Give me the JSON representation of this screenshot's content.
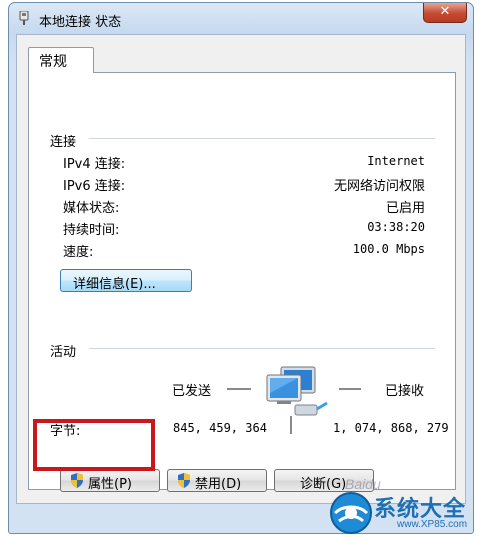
{
  "window": {
    "title": "本地连接 状态",
    "close_label": "✕"
  },
  "tabs": [
    {
      "label": "常规"
    }
  ],
  "connection": {
    "section_title": "连接",
    "rows": [
      {
        "label": "IPv4 连接:",
        "value": "Internet"
      },
      {
        "label": "IPv6 连接:",
        "value": "无网络访问权限"
      },
      {
        "label": "媒体状态:",
        "value": "已启用"
      },
      {
        "label": "持续时间:",
        "value": "03:38:20"
      },
      {
        "label": "速度:",
        "value": "100.0 Mbps"
      }
    ],
    "details_button": "详细信息(E)..."
  },
  "activity": {
    "section_title": "活动",
    "sent_label": "已发送",
    "received_label": "已接收",
    "bytes_label": "字节:",
    "bytes_sent": "845, 459, 364",
    "bytes_received": "1, 074, 868, 279"
  },
  "buttons": {
    "properties": "属性(P)",
    "disable": "禁用(D)",
    "diagnose": "诊断(G)"
  },
  "watermark": {
    "brand": "系统大全",
    "url": "www.XP85.com",
    "baidu": "Baidu"
  },
  "colors": {
    "highlight": "#c9171e",
    "brand": "#1f6fb5"
  }
}
